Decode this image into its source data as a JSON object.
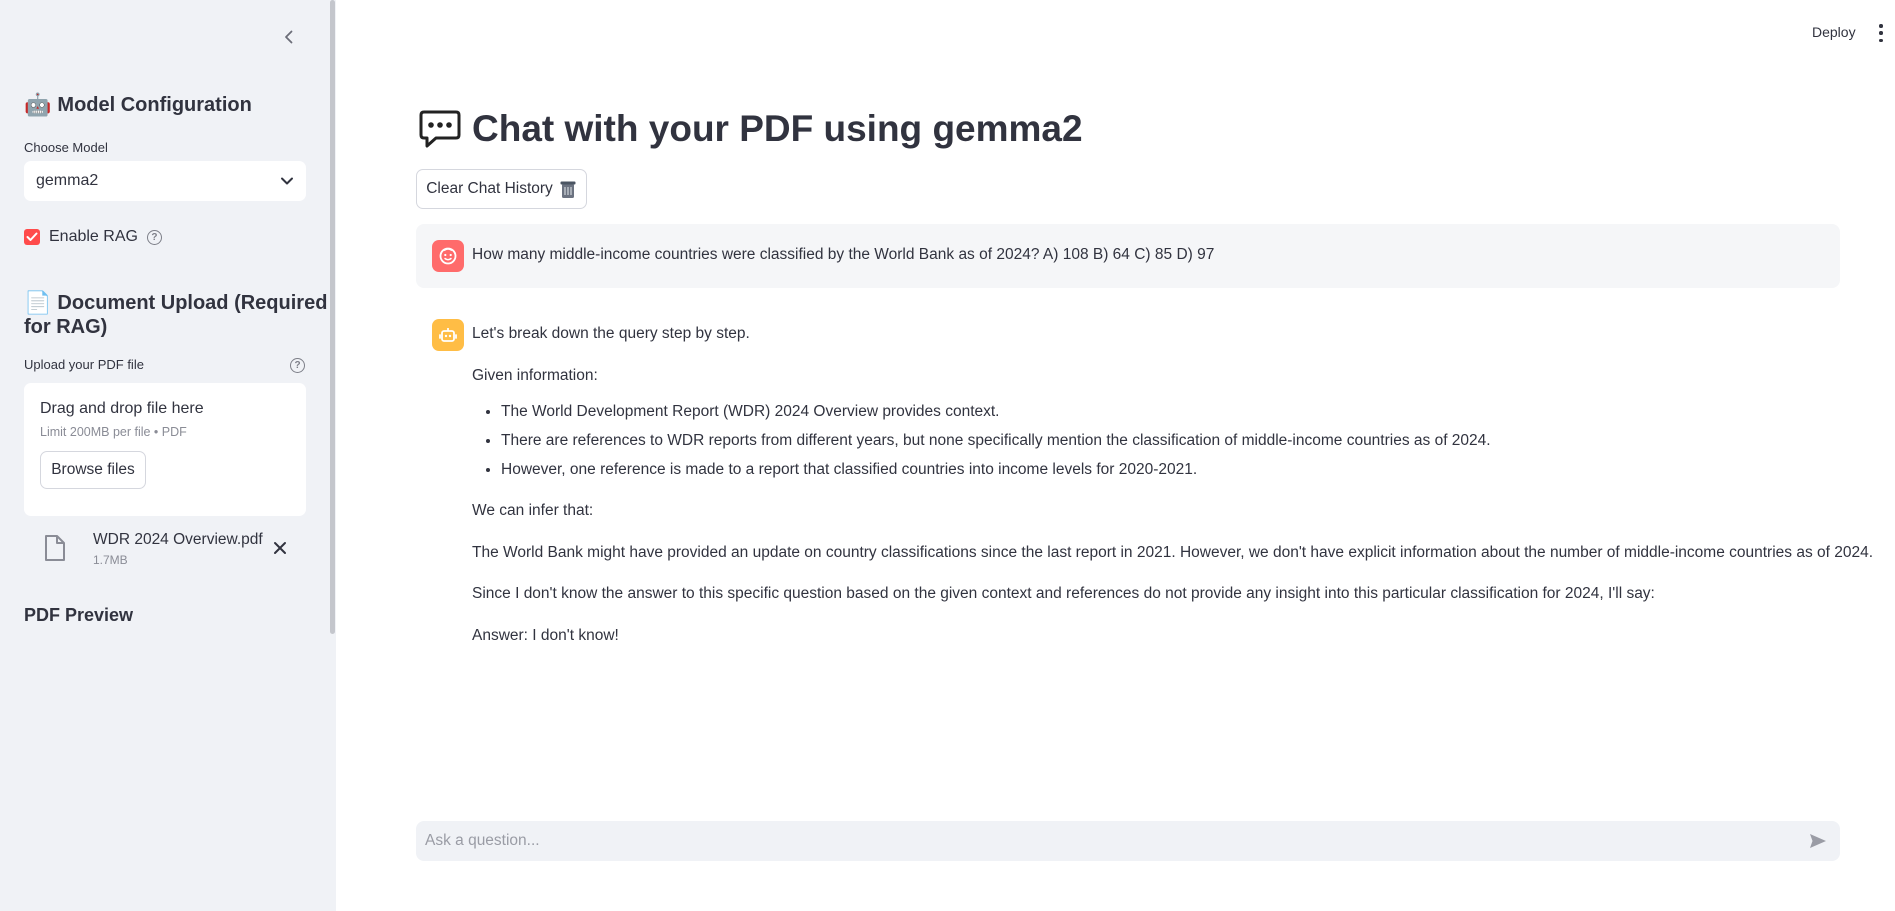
{
  "header": {
    "deploy_label": "Deploy",
    "menu_icon": "kebab-menu-icon"
  },
  "sidebar": {
    "collapse_icon": "chevron-left-icon",
    "model_section": {
      "icon": "robot-emoji",
      "title": "Model Configuration",
      "choose_model_label": "Choose Model",
      "selected_model": "gemma2"
    },
    "rag": {
      "label": "Enable RAG",
      "checked": true
    },
    "upload_section": {
      "icon": "page-emoji",
      "title_line1": "Document Upload (Required",
      "title_line2": "for RAG)",
      "upload_label": "Upload your PDF file",
      "dropzone_title": "Drag and drop file here",
      "dropzone_limit": "Limit 200MB per file • PDF",
      "browse_label": "Browse files",
      "file": {
        "name": "WDR 2024 Overview.pdf",
        "size": "1.7MB"
      }
    },
    "pdf_preview_title": "PDF Preview"
  },
  "main": {
    "title": "Chat with your PDF using gemma2",
    "title_icon": "speech-balloon-emoji",
    "clear_button_label": "Clear Chat History",
    "clear_button_icon": "wastebasket-emoji",
    "messages": {
      "user": {
        "avatar": "user-face-icon",
        "text": "How many middle-income countries were classified by the World Bank as of 2024? A) 108 B) 64 C) 85 D) 97"
      },
      "assistant": {
        "avatar": "robot-icon",
        "intro": "Let's break down the query step by step.",
        "given_label": "Given information:",
        "bullets": [
          "The World Development Report (WDR) 2024 Overview provides context.",
          "There are references to WDR reports from different years, but none specifically mention the classification of middle-income countries as of 2024.",
          "However, one reference is made to a report that classified countries into income levels for 2020-2021."
        ],
        "infer_label": "We can infer that:",
        "inference": "The World Bank might have provided an update on country classifications since the last report in 2021. However, we don't have explicit information about the number of middle-income countries as of 2024.",
        "conclusion": "Since I don't know the answer to this specific question based on the given context and references do not provide any insight into this particular classification for 2024, I'll say:",
        "answer": "Answer: I don't know!"
      }
    },
    "chat_input": {
      "placeholder": "Ask a question...",
      "value": ""
    }
  },
  "colors": {
    "accent": "#ff4b4b",
    "sidebar_bg": "#f0f2f6",
    "user_avatar": "#ff6b6b",
    "bot_avatar": "#ffbd45"
  }
}
